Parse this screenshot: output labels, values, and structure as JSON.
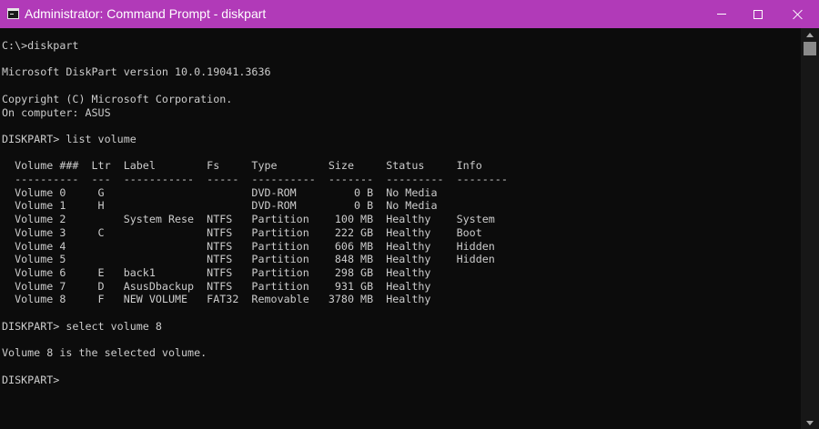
{
  "window": {
    "title": "Administrator: Command Prompt - diskpart",
    "titlebar_color": "#b13ab8",
    "icon": "cmd-app-icon"
  },
  "controls": {
    "minimize_icon": "minimize-icon",
    "maximize_icon": "maximize-icon",
    "close_icon": "close-icon"
  },
  "console": {
    "background": "#0c0c0c",
    "text_color": "#cccccc",
    "lines": [
      "C:\\>diskpart",
      "",
      "Microsoft DiskPart version 10.0.19041.3636",
      "",
      "Copyright (C) Microsoft Corporation.",
      "On computer: ASUS",
      "",
      "DISKPART> list volume",
      "",
      "  Volume ###  Ltr  Label        Fs     Type        Size     Status     Info",
      "  ----------  ---  -----------  -----  ----------  -------  ---------  --------",
      "  Volume 0     G                       DVD-ROM         0 B  No Media",
      "  Volume 1     H                       DVD-ROM         0 B  No Media",
      "  Volume 2         System Rese  NTFS   Partition    100 MB  Healthy    System",
      "  Volume 3     C                NTFS   Partition    222 GB  Healthy    Boot",
      "  Volume 4                      NTFS   Partition    606 MB  Healthy    Hidden",
      "  Volume 5                      NTFS   Partition    848 MB  Healthy    Hidden",
      "  Volume 6     E   back1        NTFS   Partition    298 GB  Healthy",
      "  Volume 7     D   AsusDbackup  NTFS   Partition    931 GB  Healthy",
      "  Volume 8     F   NEW VOLUME   FAT32  Removable   3780 MB  Healthy",
      "",
      "DISKPART> select volume 8",
      "",
      "Volume 8 is the selected volume.",
      "",
      "DISKPART>"
    ]
  }
}
